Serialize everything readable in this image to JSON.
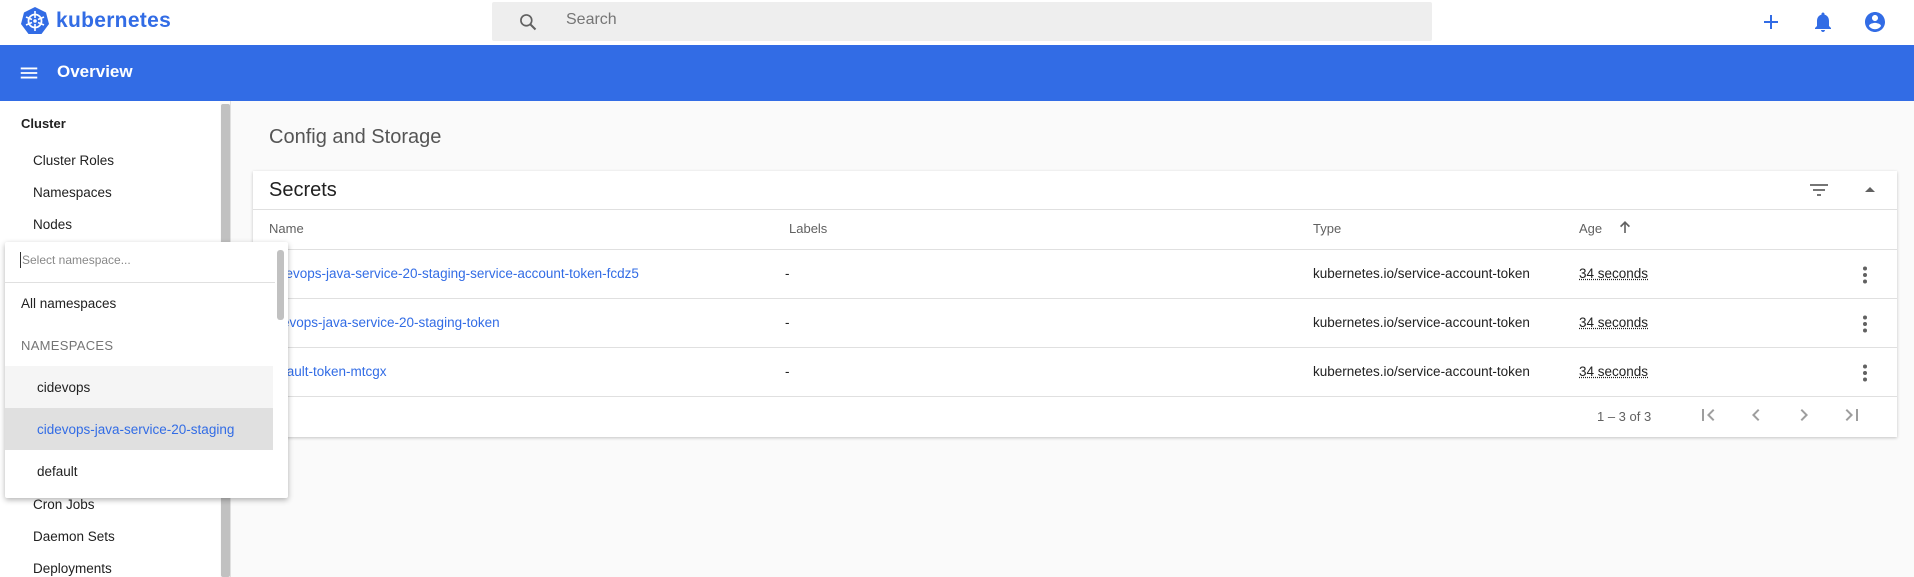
{
  "app": {
    "brand": "kubernetes"
  },
  "search": {
    "placeholder": "Search"
  },
  "toolbar": {
    "title": "Overview"
  },
  "sidebar": {
    "heading_cluster": "Cluster",
    "items_top": [
      "Cluster Roles",
      "Namespaces",
      "Nodes"
    ],
    "items_bottom": [
      "Cron Jobs",
      "Daemon Sets",
      "Deployments"
    ]
  },
  "main": {
    "section_title": "Config and Storage"
  },
  "secrets": {
    "title": "Secrets",
    "columns": {
      "name": "Name",
      "labels": "Labels",
      "type": "Type",
      "age": "Age"
    },
    "rows": [
      {
        "name": "idevops-java-service-20-staging-service-account-token-fcdz5",
        "labels": "-",
        "type": "kubernetes.io/service-account-token",
        "age": "34 seconds"
      },
      {
        "name": "ievops-java-service-20-staging-token",
        "labels": "-",
        "type": "kubernetes.io/service-account-token",
        "age": "34 seconds"
      },
      {
        "name": "fault-token-mtcgx",
        "labels": "-",
        "type": "kubernetes.io/service-account-token",
        "age": "34 seconds"
      }
    ],
    "pagination": "1 – 3 of 3"
  },
  "namespace_dropdown": {
    "placeholder": "Select namespace...",
    "all_label": "All namespaces",
    "group_label": "NAMESPACES",
    "options": [
      "cidevops",
      "cidevops-java-service-20-staging",
      "default"
    ],
    "selected": "cidevops-java-service-20-staging"
  },
  "colors": {
    "brand": "#326ce5",
    "toolbar": "#326ce5",
    "selected_bg": "#e0e0e0",
    "hover_bg": "#f5f5f5"
  },
  "icons": [
    "kubernetes-logo",
    "search-icon",
    "add-icon",
    "notifications-icon",
    "account-icon",
    "menu-icon",
    "filter-icon",
    "collapse-icon",
    "sort-arrow-up-icon",
    "more-vert-icon",
    "first-page-icon",
    "prev-page-icon",
    "next-page-icon",
    "last-page-icon"
  ]
}
